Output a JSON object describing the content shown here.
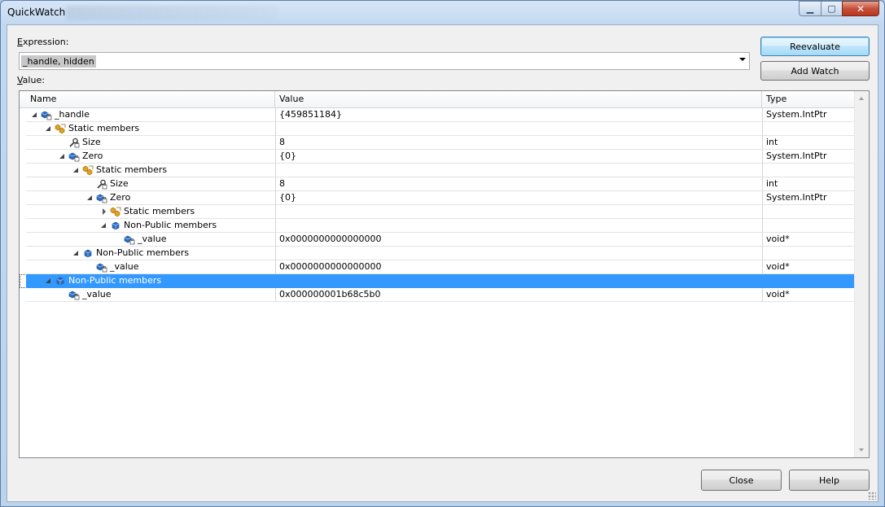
{
  "window": {
    "title": "QuickWatch",
    "controls": {
      "minimize": "▁",
      "maximize": "▢",
      "close": "✕"
    }
  },
  "expression": {
    "label_prefix": "",
    "label_access": "E",
    "label_rest": "xpression:",
    "value": "_handle, hidden"
  },
  "value_label": {
    "access": "V",
    "rest": "alue:"
  },
  "buttons": {
    "reevaluate": "Reevaluate",
    "add_watch": "Add Watch",
    "close": "Close",
    "help": "Help"
  },
  "grid": {
    "columns": {
      "name": "Name",
      "value": "Value",
      "type": "Type"
    },
    "rows": [
      {
        "name": "_handle",
        "value": "{459851184}",
        "type": "System.IntPtr",
        "level": 0,
        "expander": "open",
        "icon": "field-locked"
      },
      {
        "name": "Static members",
        "value": "",
        "type": "",
        "level": 1,
        "expander": "open",
        "icon": "static"
      },
      {
        "name": "Size",
        "value": "8",
        "type": "int",
        "level": 2,
        "expander": "none",
        "icon": "property-locked"
      },
      {
        "name": "Zero",
        "value": "{0}",
        "type": "System.IntPtr",
        "level": 2,
        "expander": "open",
        "icon": "field-locked"
      },
      {
        "name": "Static members",
        "value": "",
        "type": "",
        "level": 3,
        "expander": "open",
        "icon": "static"
      },
      {
        "name": "Size",
        "value": "8",
        "type": "int",
        "level": 4,
        "expander": "none",
        "icon": "property-locked"
      },
      {
        "name": "Zero",
        "value": "{0}",
        "type": "System.IntPtr",
        "level": 4,
        "expander": "open",
        "icon": "field-locked"
      },
      {
        "name": "Static members",
        "value": "",
        "type": "",
        "level": 5,
        "expander": "closed",
        "icon": "static"
      },
      {
        "name": "Non-Public members",
        "value": "",
        "type": "",
        "level": 5,
        "expander": "open",
        "icon": "nonpublic"
      },
      {
        "name": "_value",
        "value": "0x0000000000000000",
        "type": "void*",
        "level": 6,
        "expander": "none",
        "icon": "field-locked"
      },
      {
        "name": "Non-Public members",
        "value": "",
        "type": "",
        "level": 3,
        "expander": "open",
        "icon": "nonpublic"
      },
      {
        "name": "_value",
        "value": "0x0000000000000000",
        "type": "void*",
        "level": 4,
        "expander": "none",
        "icon": "field-locked"
      },
      {
        "name": "Non-Public members",
        "value": "",
        "type": "",
        "level": 1,
        "expander": "open",
        "icon": "nonpublic",
        "selected": true
      },
      {
        "name": "_value",
        "value": "0x000000001b68c5b0",
        "type": "void*",
        "level": 2,
        "expander": "none",
        "icon": "field-locked"
      }
    ]
  },
  "colors": {
    "selection": "#3399ff",
    "field_icon": "#2a6cc0",
    "static_icon": "#e0a020"
  }
}
